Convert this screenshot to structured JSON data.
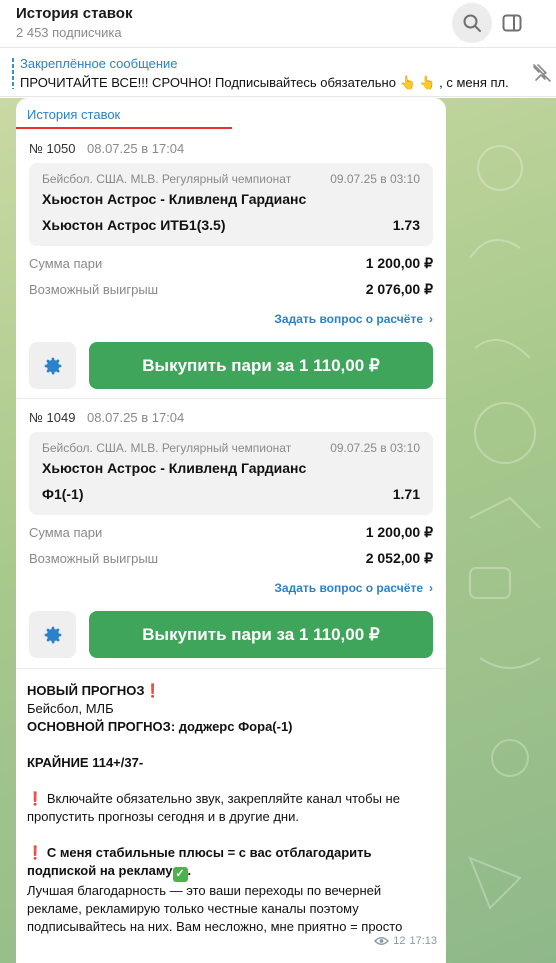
{
  "header": {
    "title": "История ставок",
    "subscribers": "2 453 подписчика"
  },
  "pinned": {
    "label": "Закреплённое сообщение",
    "text": "ПРОЧИТАЙТЕ ВСЕ!!! СРОЧНО! Подписывайтесь обязательно 👆 👆 , с меня пл..."
  },
  "bet_history": {
    "title": "История ставок",
    "bets": [
      {
        "number": "№ 1050",
        "date": "08.07.25 в 17:04",
        "sport": "Бейсбол. США. MLB. Регулярный чемпионат",
        "event_time": "09.07.25 в 03:10",
        "teams": "Хьюстон Астрос - Кливленд Гардианс",
        "market": "Хьюстон Астрос ИТБ1(3.5)",
        "odds": "1.73",
        "stake_label": "Сумма пари",
        "stake": "1 200,00 ₽",
        "win_label": "Возможный выигрыш",
        "win": "2 076,00 ₽",
        "ask": "Задать вопрос о расчёте",
        "buyout": "Выкупить пари за 1 110,00 ₽"
      },
      {
        "number": "№ 1049",
        "date": "08.07.25 в 17:04",
        "sport": "Бейсбол. США. MLB. Регулярный чемпионат",
        "event_time": "09.07.25 в 03:10",
        "teams": "Хьюстон Астрос - Кливленд Гардианс",
        "market": "Ф1(-1)",
        "odds": "1.71",
        "stake_label": "Сумма пари",
        "stake": "1 200,00 ₽",
        "win_label": "Возможный выигрыш",
        "win": "2 052,00 ₽",
        "ask": "Задать вопрос о расчёте",
        "buyout": "Выкупить пари за 1 110,00 ₽"
      }
    ]
  },
  "message": {
    "line1": "НОВЫЙ ПРОГНОЗ",
    "line2": "Бейсбол, МЛБ",
    "line3": "ОСНОВНОЙ ПРОГНОЗ: доджерс Фора(-1)",
    "line4": "КРАЙНИЕ 114+/37-",
    "para1": "Включайте обязательно звук, закрепляйте канал чтобы не пропустить прогнозы сегодня и в другие дни.",
    "para2_bold": "С меня стабильные плюсы = с вас отблагодарить подпиской на рекламу",
    "para3": "Лучшая благодарность — это ваши переходы по вечерней рекламе,  рекламирую только честные каналы поэтому подписывайтесь на них. Вам несложно, мне приятно = просто",
    "views": "12",
    "time": "17:13"
  },
  "colors": {
    "accent": "#2b82c8",
    "buyout_green": "#3fa55b",
    "red_marker": "#d6262a"
  }
}
